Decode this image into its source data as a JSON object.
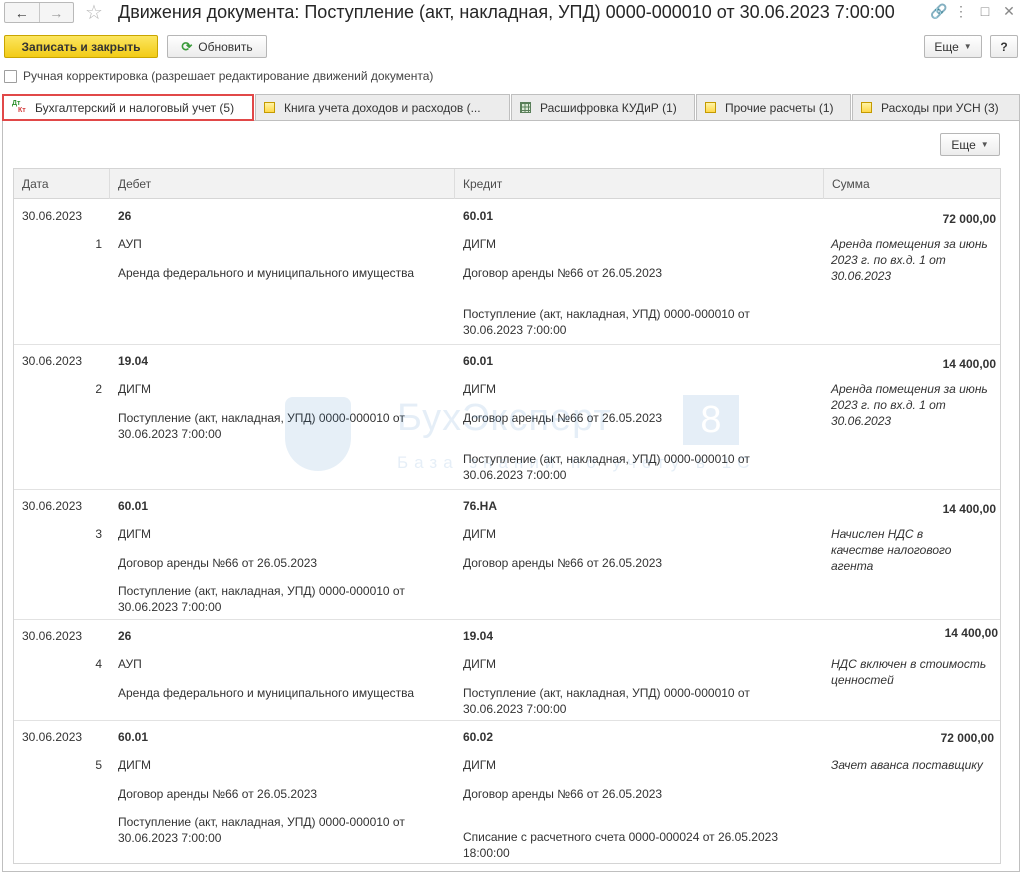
{
  "window": {
    "title": "Движения документа: Поступление (акт, накладная, УПД) 0000-000010 от 30.06.2023 7:00:00"
  },
  "toolbar": {
    "save_close": "Записать и закрыть",
    "refresh": "Обновить",
    "more": "Еще",
    "help": "?"
  },
  "manual_correction": {
    "label": "Ручная корректировка (разрешает редактирование движений документа)",
    "checked": false
  },
  "tabs": [
    {
      "label": "Бухгалтерский и налоговый учет (5)",
      "icon": "dt-kt-icon",
      "active": true
    },
    {
      "label": "Книга учета доходов и расходов (...",
      "icon": "register-book-icon",
      "active": false
    },
    {
      "label": "Расшифровка КУДиР (1)",
      "icon": "table-grid-icon",
      "active": false
    },
    {
      "label": "Прочие расчеты (1)",
      "icon": "register-book-icon",
      "active": false
    },
    {
      "label": "Расходы при УСН (3)",
      "icon": "register-book-icon",
      "active": false
    }
  ],
  "tab_icon_text": {
    "dt": "Дт",
    "kt": "Кт"
  },
  "table": {
    "more": "Еще",
    "columns": {
      "date": "Дата",
      "debit": "Дебет",
      "credit": "Кредит",
      "sum": "Сумма"
    },
    "rows": [
      {
        "date": "30.06.2023",
        "num": "1",
        "debit": [
          "26",
          "АУП",
          "Аренда федерального и муниципального имущества"
        ],
        "credit": [
          "60.01",
          "ДИГМ",
          "Договор аренды №66 от 26.05.2023",
          "Поступление (акт, накладная, УПД) 0000-000010 от 30.06.2023 7:00:00"
        ],
        "amount": "72 000,00",
        "note": "Аренда помещения за июнь 2023 г. по вх.д. 1 от 30.06.2023"
      },
      {
        "date": "30.06.2023",
        "num": "2",
        "debit": [
          "19.04",
          "ДИГМ",
          "Поступление (акт, накладная, УПД) 0000-000010 от 30.06.2023 7:00:00"
        ],
        "credit": [
          "60.01",
          "ДИГМ",
          "Договор аренды №66 от 26.05.2023",
          "Поступление (акт, накладная, УПД) 0000-000010 от 30.06.2023 7:00:00"
        ],
        "amount": "14 400,00",
        "note": "Аренда помещения за июнь 2023 г. по вх.д. 1 от 30.06.2023"
      },
      {
        "date": "30.06.2023",
        "num": "3",
        "debit": [
          "60.01",
          "ДИГМ",
          "Договор аренды №66 от 26.05.2023",
          "Поступление (акт, накладная, УПД) 0000-000010 от 30.06.2023 7:00:00"
        ],
        "credit": [
          "76.НА",
          "ДИГМ",
          "Договор аренды №66 от 26.05.2023"
        ],
        "amount": "14 400,00",
        "note": "Начислен НДС в качестве налогового агента"
      },
      {
        "date": "30.06.2023",
        "num": "4",
        "debit": [
          "26",
          "АУП",
          "Аренда федерального и муниципального имущества"
        ],
        "credit": [
          "19.04",
          "ДИГМ",
          "Поступление (акт, накладная, УПД) 0000-000010 от 30.06.2023 7:00:00"
        ],
        "amount": "14 400,00",
        "note": "НДС включен в стоимость ценностей"
      },
      {
        "date": "30.06.2023",
        "num": "5",
        "debit": [
          "60.01",
          "ДИГМ",
          "Договор аренды №66 от 26.05.2023",
          "Поступление (акт, накладная, УПД) 0000-000010 от 30.06.2023 7:00:00"
        ],
        "credit": [
          "60.02",
          "ДИГМ",
          "Договор аренды №66 от 26.05.2023",
          "Списание с расчетного счета 0000-000024 от 26.05.2023 18:00:00"
        ],
        "amount": "72 000,00",
        "note": "Зачет аванса поставщику"
      }
    ]
  },
  "watermark": {
    "brand": "БухЭксперт",
    "number": "8",
    "subtitle": "База знаний по учету в 1С"
  },
  "colors": {
    "primary_button": "#f2cb16",
    "active_tab_outline": "#e14848",
    "watermark": "#2f7bbf"
  }
}
